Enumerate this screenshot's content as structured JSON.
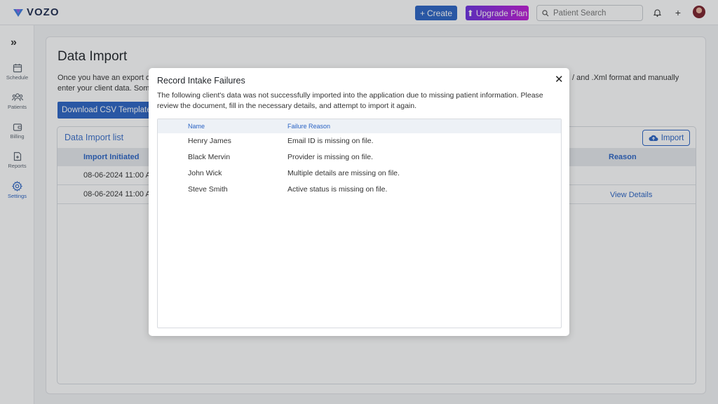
{
  "app": {
    "logo_text": "VOZO"
  },
  "header": {
    "create_label": "Create",
    "upgrade_label": "Upgrade Plan",
    "search_placeholder": "Patient Search",
    "accent": "#2a63c4"
  },
  "sidebar": {
    "items": [
      {
        "label": "Schedule",
        "icon": "calendar-icon"
      },
      {
        "label": "Patients",
        "icon": "patients-icon"
      },
      {
        "label": "Billing",
        "icon": "wallet-icon"
      },
      {
        "label": "Reports",
        "icon": "report-icon"
      },
      {
        "label": "Settings",
        "icon": "gear-icon",
        "active": true
      }
    ]
  },
  "page": {
    "title": "Data Import",
    "intro_left": "Once you have an export o",
    "intro_left_2": "enter your client data. Som",
    "intro_right": "/ and .Xml format and manually",
    "download_label": "Download CSV Template",
    "list_title": "Data Import list",
    "import_label": "Import",
    "columns": {
      "initiated": "Import Initiated",
      "reason": "Reason"
    },
    "rows": [
      {
        "initiated": "08-06-2024 11:00 A",
        "reason": ""
      },
      {
        "initiated": "08-06-2024 11:00 A",
        "reason": "View Details"
      }
    ]
  },
  "modal": {
    "title": "Record Intake Failures",
    "description": "The following client's data was not successfully imported into the application due to missing patient information. Please review the document, fill in the necessary details, and attempt to import it again.",
    "columns": {
      "name": "Name",
      "reason": "Failure Reason"
    },
    "rows": [
      {
        "name": "Henry James",
        "reason": "Email ID is missing on file."
      },
      {
        "name": "Black Mervin",
        "reason": "Provider is missing on file."
      },
      {
        "name": "John Wick",
        "reason": "Multiple details are missing on file."
      },
      {
        "name": "Steve Smith",
        "reason": "Active status is missing on file."
      }
    ]
  }
}
